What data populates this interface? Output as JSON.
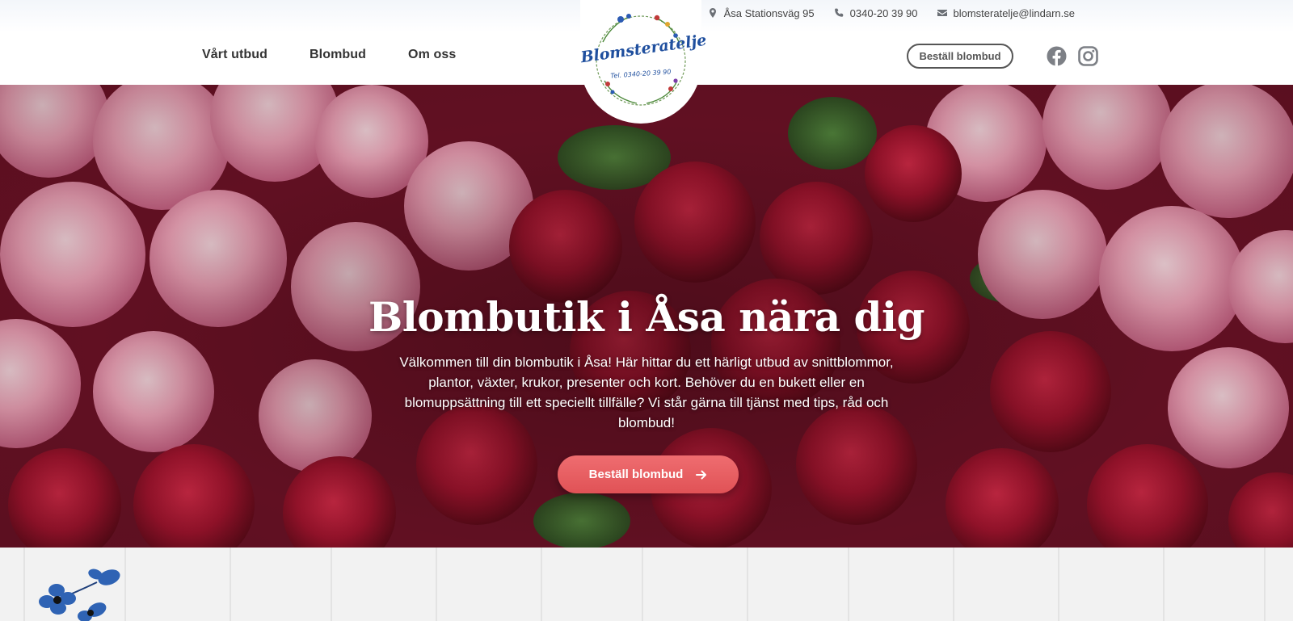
{
  "header": {
    "contact": {
      "address": "Åsa Stationsväg 95",
      "phone": "0340-20 39 90",
      "email": "blomsteratelje@lindarn.se"
    },
    "nav": [
      "Vårt utbud",
      "Blombud",
      "Om oss"
    ],
    "order_label": "Beställ blombud",
    "social": [
      "facebook-icon",
      "instagram-icon"
    ]
  },
  "logo": {
    "name": "Blomsteratelje",
    "tel": "Tel. 0340-20 39 90"
  },
  "hero": {
    "title": "Blombutik i Åsa nära dig",
    "text": "Välkommen till din blombutik i Åsa! Här hittar du ett härligt utbud av snittblommor, plantor, växter, krukor, presenter och kort. Behöver du en bukett eller en blomuppsättning till ett speciellt tillfälle? Vi står gärna till tjänst med tips, råd och blombud!",
    "cta_label": "Beställ blombud"
  },
  "colors": {
    "accent": "#e65a5e",
    "logo_blue": "#1f4f9e",
    "rose_red": "#b0162e",
    "rose_pink": "#f3b3c5"
  }
}
